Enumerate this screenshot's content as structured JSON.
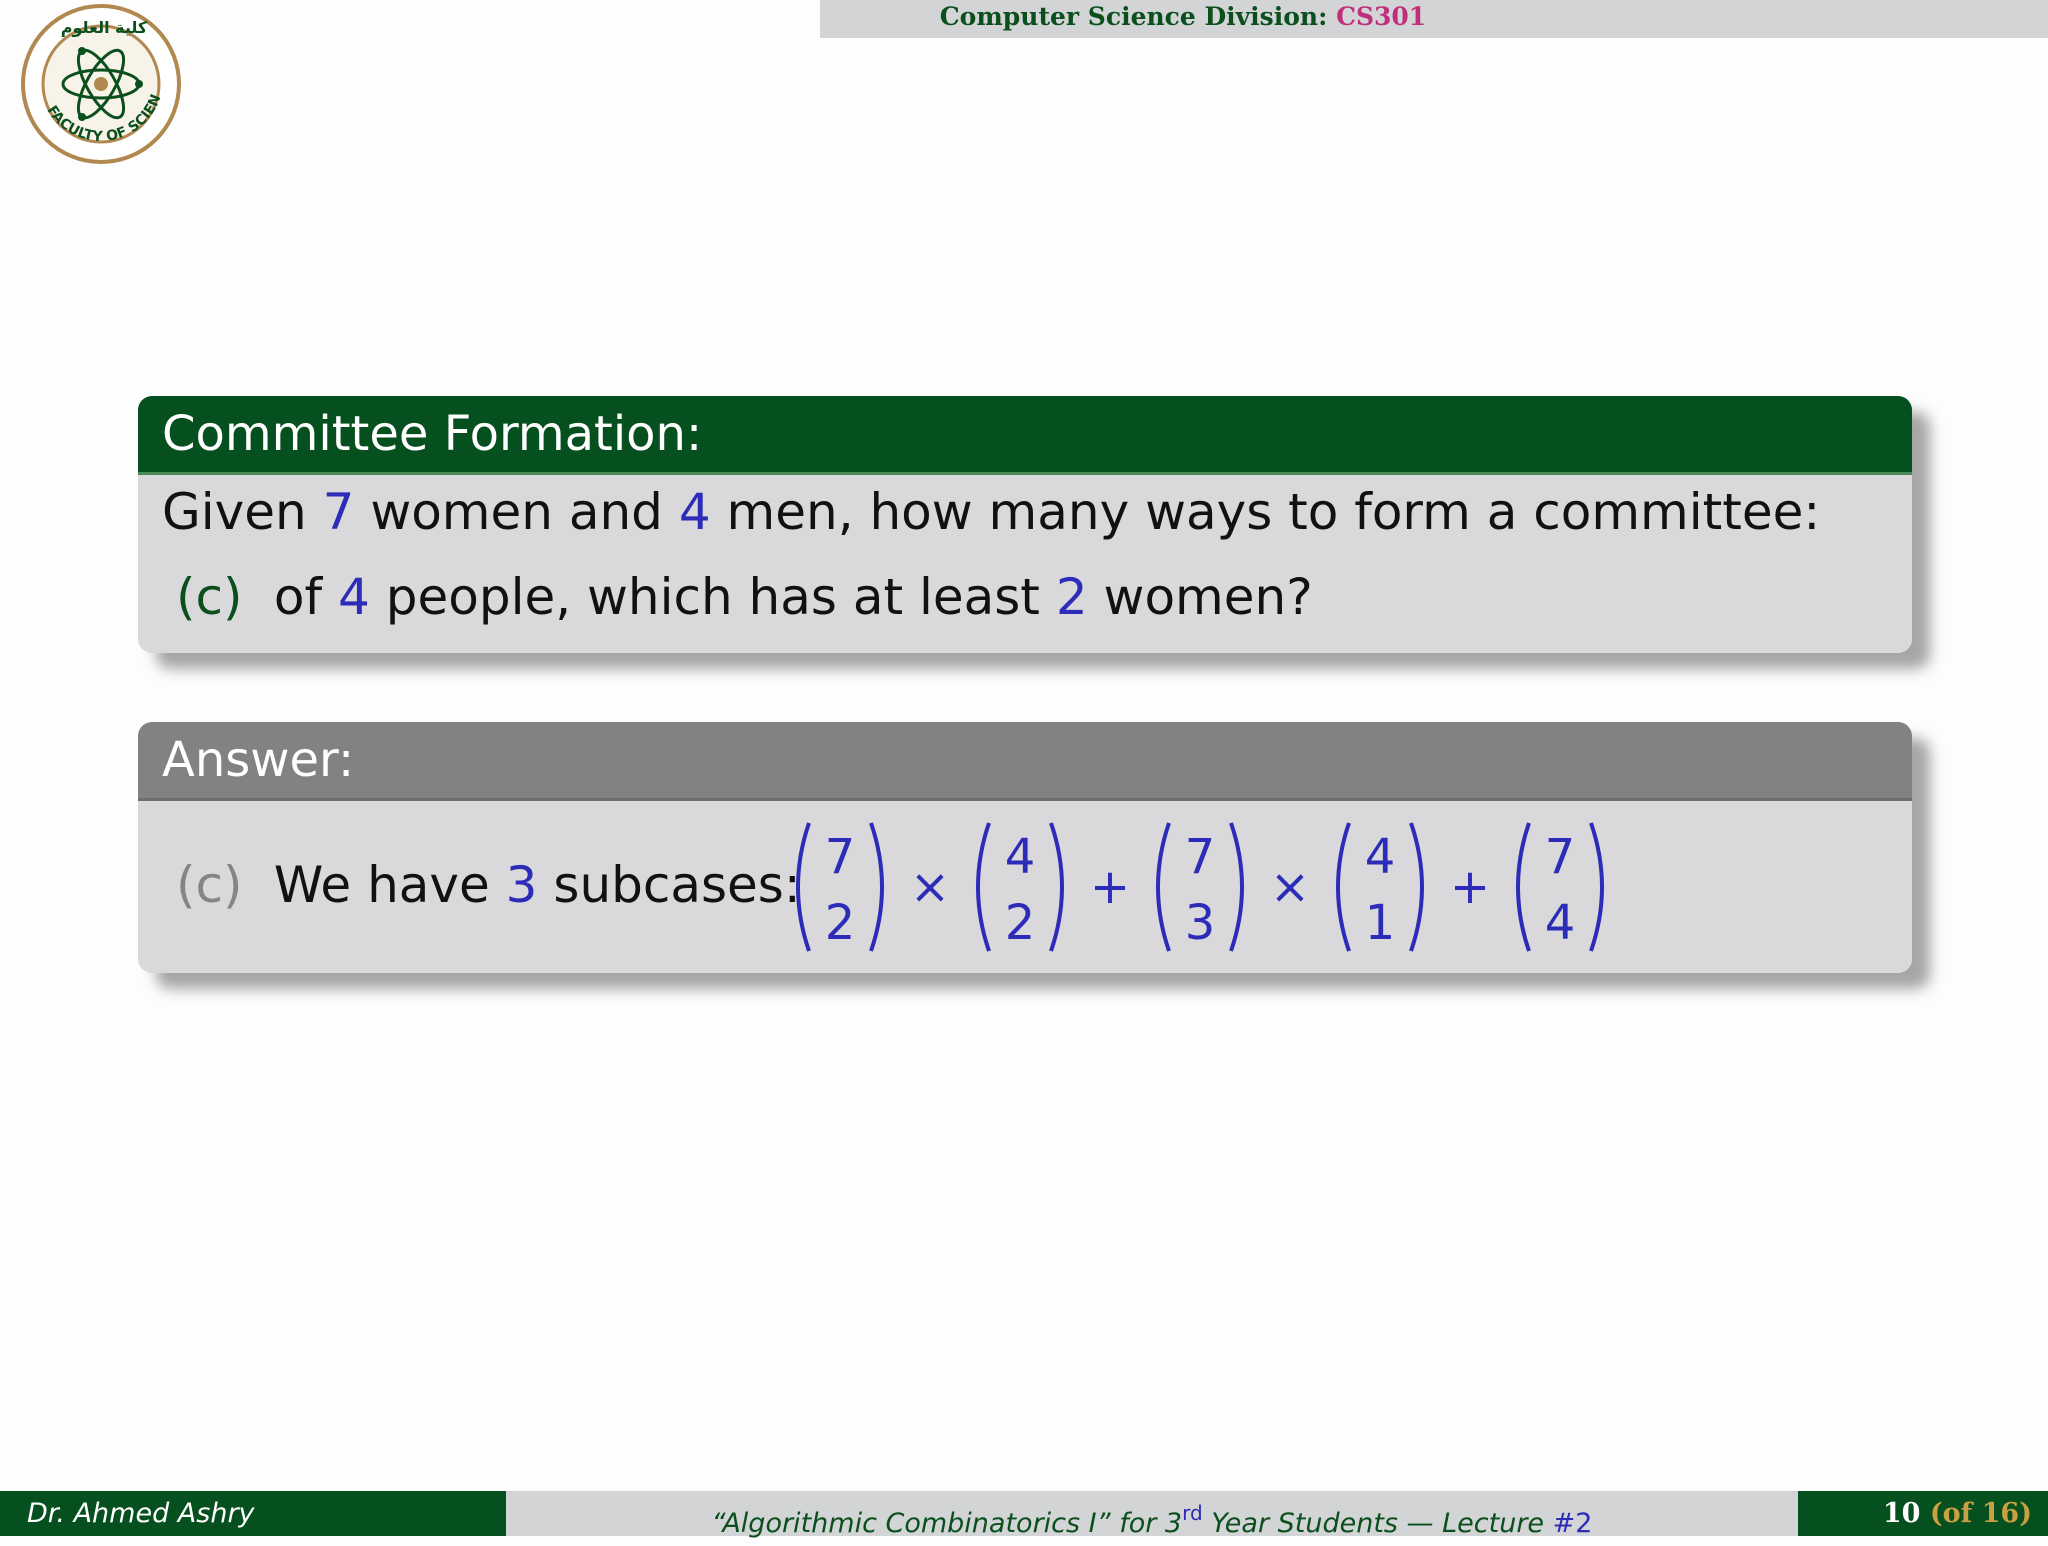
{
  "header": {
    "division": "Computer Science Division:",
    "course_code": "CS301"
  },
  "logo": {
    "text": "FACULTY OF SCIENCE",
    "arabic": "كلية العلوم"
  },
  "problem": {
    "title": "Committee Formation:",
    "line1": {
      "t1": "Given",
      "n1": "7",
      "t2": "women and",
      "n2": "4",
      "t3": "men, how many ways to form a committee:"
    },
    "item": {
      "label": "(c)",
      "t1": "of",
      "n1": "4",
      "t2": "people, which has at least",
      "n2": "2",
      "t3": "women?"
    }
  },
  "answer": {
    "title": "Answer:",
    "item": {
      "label": "(c)",
      "t1": "We have",
      "n1": "3",
      "t2": "subcases:"
    },
    "formula": {
      "terms": [
        {
          "n": "7",
          "k": "2"
        },
        {
          "n": "4",
          "k": "2"
        },
        {
          "n": "7",
          "k": "3"
        },
        {
          "n": "4",
          "k": "1"
        },
        {
          "n": "7",
          "k": "4"
        }
      ],
      "operators": [
        "×",
        "+",
        "×",
        "+"
      ]
    }
  },
  "footer": {
    "author": "Dr. Ahmed Ashry",
    "course": "“Algorithmic Combinatorics I”  for 3",
    "sup": "rd",
    "rest": " Year Students — Lecture ",
    "lecture": "#2",
    "page_current": "10",
    "page_total": "(of 16)"
  },
  "colors": {
    "green": "#064f1f",
    "blue": "#2c2cb8",
    "magenta": "#c0307a",
    "gold": "#c9a042"
  }
}
